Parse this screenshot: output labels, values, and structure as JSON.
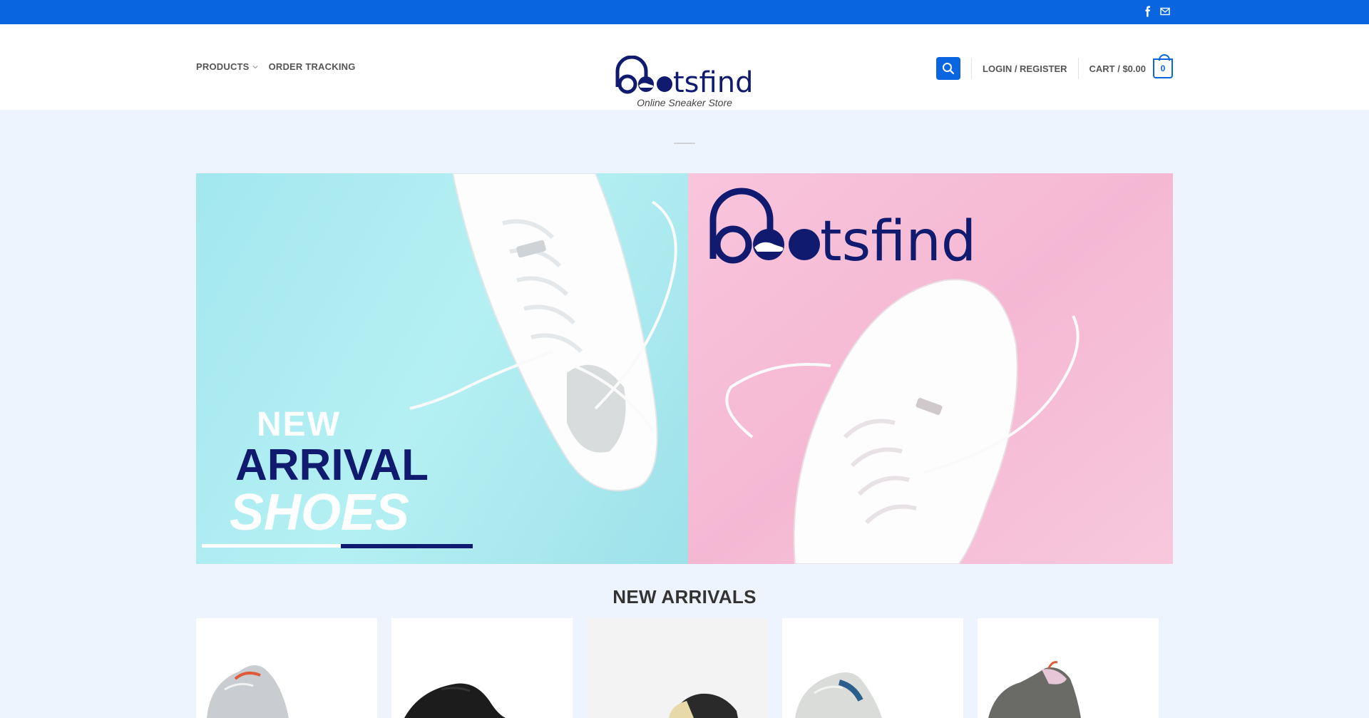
{
  "site": {
    "brand": "bootsfind",
    "tagline": "Online Sneaker Store"
  },
  "topbar": {
    "social_icons": [
      "facebook-icon",
      "envelope-icon"
    ],
    "background": "#0a66e0"
  },
  "nav": {
    "left": [
      {
        "label": "PRODUCTS",
        "has_dropdown": true
      },
      {
        "label": "ORDER TRACKING",
        "has_dropdown": false
      }
    ],
    "right": {
      "search_icon": "search-icon",
      "login_label": "LOGIN / REGISTER",
      "cart_label": "CART / $0.00",
      "cart_count": "0"
    }
  },
  "banner": {
    "line1": "NEW",
    "line2": "ARRIVAL",
    "line3": "SHOES",
    "logo_text": "bootsfind",
    "left_color": "#a8eaf0",
    "right_color": "#f7c0d8"
  },
  "section": {
    "title": "NEW ARRIVALS"
  },
  "products": [
    {
      "shoe_color": "#c9ccd0",
      "accent": "#e05a3a"
    },
    {
      "shoe_color": "#1c1c1c",
      "accent": "#333333"
    },
    {
      "shoe_color": "#2a2a2a",
      "accent": "#e8d9a8"
    },
    {
      "shoe_color": "#d9dcd8",
      "accent": "#2a5e8c"
    },
    {
      "shoe_color": "#6a6a66",
      "accent": "#e7c6d8"
    }
  ],
  "colors": {
    "accent": "#0a66e0",
    "navy": "#101a6e",
    "page_bg": "#eef4fd"
  }
}
